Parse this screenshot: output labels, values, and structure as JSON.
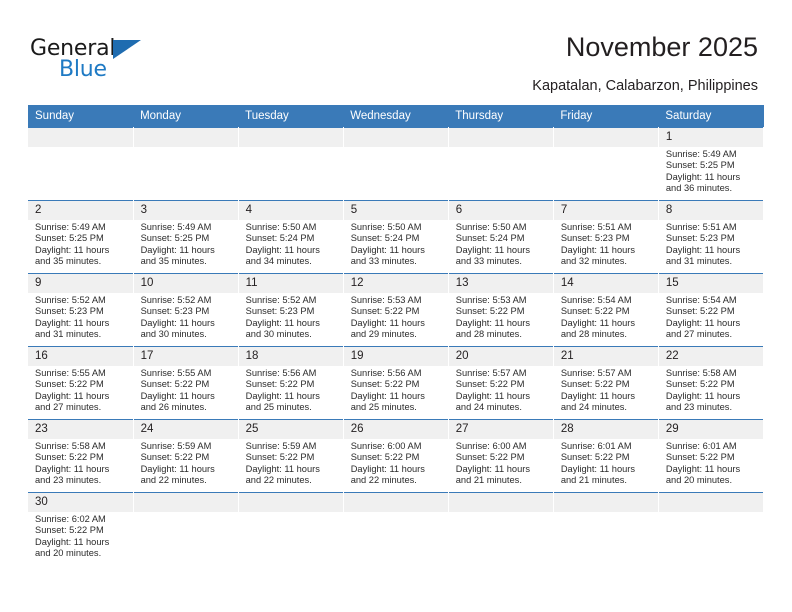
{
  "brand": {
    "name_part1": "General",
    "name_part2": "Blue",
    "accent_color": "#1f7ac4",
    "triangle_color": "#1f6cb0"
  },
  "header": {
    "title": "November 2025",
    "subtitle": "Kapatalan, Calabarzon, Philippines"
  },
  "calendar": {
    "header_background": "#3a7ab8",
    "daynum_background": "#f0f0f0",
    "weekday_headers": [
      "Sunday",
      "Monday",
      "Tuesday",
      "Wednesday",
      "Thursday",
      "Friday",
      "Saturday"
    ],
    "weeks": [
      [
        {
          "day": "",
          "lines": []
        },
        {
          "day": "",
          "lines": []
        },
        {
          "day": "",
          "lines": []
        },
        {
          "day": "",
          "lines": []
        },
        {
          "day": "",
          "lines": []
        },
        {
          "day": "",
          "lines": []
        },
        {
          "day": "1",
          "lines": [
            "Sunrise: 5:49 AM",
            "Sunset: 5:25 PM",
            "Daylight: 11 hours",
            "and 36 minutes."
          ]
        }
      ],
      [
        {
          "day": "2",
          "lines": [
            "Sunrise: 5:49 AM",
            "Sunset: 5:25 PM",
            "Daylight: 11 hours",
            "and 35 minutes."
          ]
        },
        {
          "day": "3",
          "lines": [
            "Sunrise: 5:49 AM",
            "Sunset: 5:25 PM",
            "Daylight: 11 hours",
            "and 35 minutes."
          ]
        },
        {
          "day": "4",
          "lines": [
            "Sunrise: 5:50 AM",
            "Sunset: 5:24 PM",
            "Daylight: 11 hours",
            "and 34 minutes."
          ]
        },
        {
          "day": "5",
          "lines": [
            "Sunrise: 5:50 AM",
            "Sunset: 5:24 PM",
            "Daylight: 11 hours",
            "and 33 minutes."
          ]
        },
        {
          "day": "6",
          "lines": [
            "Sunrise: 5:50 AM",
            "Sunset: 5:24 PM",
            "Daylight: 11 hours",
            "and 33 minutes."
          ]
        },
        {
          "day": "7",
          "lines": [
            "Sunrise: 5:51 AM",
            "Sunset: 5:23 PM",
            "Daylight: 11 hours",
            "and 32 minutes."
          ]
        },
        {
          "day": "8",
          "lines": [
            "Sunrise: 5:51 AM",
            "Sunset: 5:23 PM",
            "Daylight: 11 hours",
            "and 31 minutes."
          ]
        }
      ],
      [
        {
          "day": "9",
          "lines": [
            "Sunrise: 5:52 AM",
            "Sunset: 5:23 PM",
            "Daylight: 11 hours",
            "and 31 minutes."
          ]
        },
        {
          "day": "10",
          "lines": [
            "Sunrise: 5:52 AM",
            "Sunset: 5:23 PM",
            "Daylight: 11 hours",
            "and 30 minutes."
          ]
        },
        {
          "day": "11",
          "lines": [
            "Sunrise: 5:52 AM",
            "Sunset: 5:23 PM",
            "Daylight: 11 hours",
            "and 30 minutes."
          ]
        },
        {
          "day": "12",
          "lines": [
            "Sunrise: 5:53 AM",
            "Sunset: 5:22 PM",
            "Daylight: 11 hours",
            "and 29 minutes."
          ]
        },
        {
          "day": "13",
          "lines": [
            "Sunrise: 5:53 AM",
            "Sunset: 5:22 PM",
            "Daylight: 11 hours",
            "and 28 minutes."
          ]
        },
        {
          "day": "14",
          "lines": [
            "Sunrise: 5:54 AM",
            "Sunset: 5:22 PM",
            "Daylight: 11 hours",
            "and 28 minutes."
          ]
        },
        {
          "day": "15",
          "lines": [
            "Sunrise: 5:54 AM",
            "Sunset: 5:22 PM",
            "Daylight: 11 hours",
            "and 27 minutes."
          ]
        }
      ],
      [
        {
          "day": "16",
          "lines": [
            "Sunrise: 5:55 AM",
            "Sunset: 5:22 PM",
            "Daylight: 11 hours",
            "and 27 minutes."
          ]
        },
        {
          "day": "17",
          "lines": [
            "Sunrise: 5:55 AM",
            "Sunset: 5:22 PM",
            "Daylight: 11 hours",
            "and 26 minutes."
          ]
        },
        {
          "day": "18",
          "lines": [
            "Sunrise: 5:56 AM",
            "Sunset: 5:22 PM",
            "Daylight: 11 hours",
            "and 25 minutes."
          ]
        },
        {
          "day": "19",
          "lines": [
            "Sunrise: 5:56 AM",
            "Sunset: 5:22 PM",
            "Daylight: 11 hours",
            "and 25 minutes."
          ]
        },
        {
          "day": "20",
          "lines": [
            "Sunrise: 5:57 AM",
            "Sunset: 5:22 PM",
            "Daylight: 11 hours",
            "and 24 minutes."
          ]
        },
        {
          "day": "21",
          "lines": [
            "Sunrise: 5:57 AM",
            "Sunset: 5:22 PM",
            "Daylight: 11 hours",
            "and 24 minutes."
          ]
        },
        {
          "day": "22",
          "lines": [
            "Sunrise: 5:58 AM",
            "Sunset: 5:22 PM",
            "Daylight: 11 hours",
            "and 23 minutes."
          ]
        }
      ],
      [
        {
          "day": "23",
          "lines": [
            "Sunrise: 5:58 AM",
            "Sunset: 5:22 PM",
            "Daylight: 11 hours",
            "and 23 minutes."
          ]
        },
        {
          "day": "24",
          "lines": [
            "Sunrise: 5:59 AM",
            "Sunset: 5:22 PM",
            "Daylight: 11 hours",
            "and 22 minutes."
          ]
        },
        {
          "day": "25",
          "lines": [
            "Sunrise: 5:59 AM",
            "Sunset: 5:22 PM",
            "Daylight: 11 hours",
            "and 22 minutes."
          ]
        },
        {
          "day": "26",
          "lines": [
            "Sunrise: 6:00 AM",
            "Sunset: 5:22 PM",
            "Daylight: 11 hours",
            "and 22 minutes."
          ]
        },
        {
          "day": "27",
          "lines": [
            "Sunrise: 6:00 AM",
            "Sunset: 5:22 PM",
            "Daylight: 11 hours",
            "and 21 minutes."
          ]
        },
        {
          "day": "28",
          "lines": [
            "Sunrise: 6:01 AM",
            "Sunset: 5:22 PM",
            "Daylight: 11 hours",
            "and 21 minutes."
          ]
        },
        {
          "day": "29",
          "lines": [
            "Sunrise: 6:01 AM",
            "Sunset: 5:22 PM",
            "Daylight: 11 hours",
            "and 20 minutes."
          ]
        }
      ],
      [
        {
          "day": "30",
          "lines": [
            "Sunrise: 6:02 AM",
            "Sunset: 5:22 PM",
            "Daylight: 11 hours",
            "and 20 minutes."
          ]
        },
        {
          "day": "",
          "lines": []
        },
        {
          "day": "",
          "lines": []
        },
        {
          "day": "",
          "lines": []
        },
        {
          "day": "",
          "lines": []
        },
        {
          "day": "",
          "lines": []
        },
        {
          "day": "",
          "lines": []
        }
      ]
    ]
  }
}
